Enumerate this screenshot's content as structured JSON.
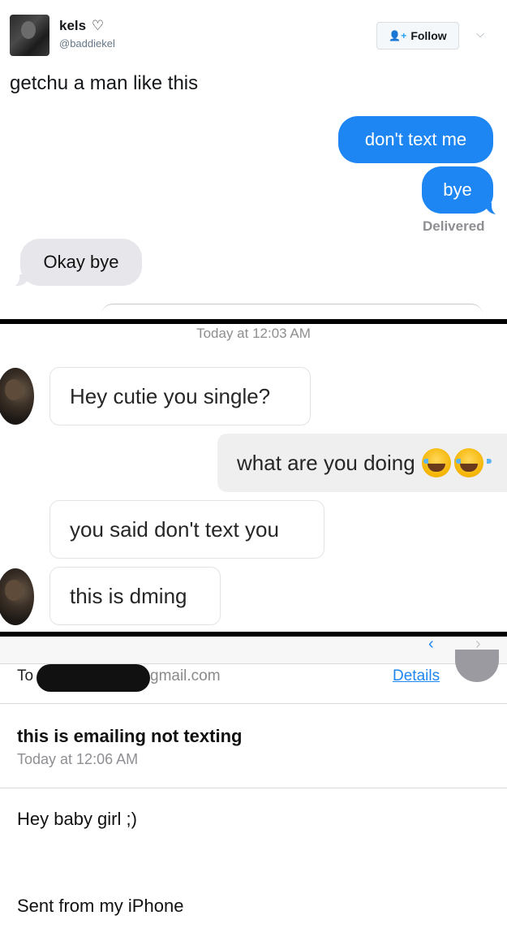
{
  "tweet": {
    "name": "kels",
    "heart": "♡",
    "handle": "@baddiekel",
    "follow_label": "Follow",
    "text": "getchu a man like this"
  },
  "imessage": {
    "sent": [
      "don't text me",
      "bye"
    ],
    "status": "Delivered",
    "received": "Okay bye"
  },
  "instagram": {
    "timestamp": "Today at 12:03 AM",
    "messages": [
      "Hey cutie you single?",
      "what are you doing",
      "you said don't text you",
      "this is dming"
    ]
  },
  "mail": {
    "to_label": "To",
    "to_address_visible": "gmail.com",
    "details_label": "Details",
    "subject": "this is emailing not texting",
    "date": "Today at 12:06 AM",
    "body": [
      "Hey baby girl ;)",
      "Sent from my iPhone"
    ]
  },
  "colors": {
    "imessage_blue": "#1e86f2",
    "imessage_gray": "#e6e6eb",
    "link_blue": "#1e86f2"
  }
}
